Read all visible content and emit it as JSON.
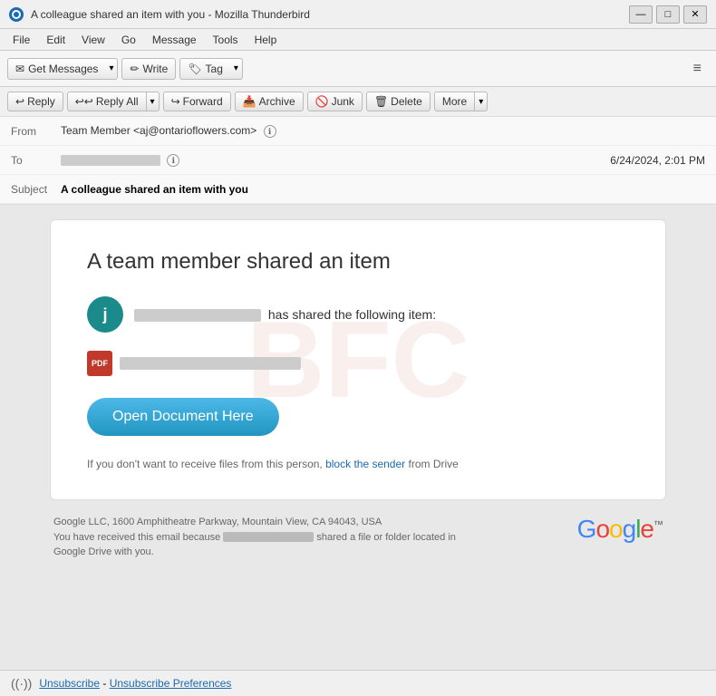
{
  "window": {
    "title": "A colleague shared an item with you - Mozilla Thunderbird",
    "controls": {
      "minimize": "—",
      "maximize": "□",
      "close": "✕"
    }
  },
  "menubar": {
    "items": [
      "File",
      "Edit",
      "View",
      "Go",
      "Message",
      "Tools",
      "Help"
    ]
  },
  "toolbar": {
    "get_messages_label": "Get Messages",
    "write_label": "Write",
    "tag_label": "Tag",
    "hamburger": "≡"
  },
  "email_actions": {
    "reply_label": "Reply",
    "reply_all_label": "Reply All",
    "forward_label": "Forward",
    "archive_label": "Archive",
    "junk_label": "Junk",
    "delete_label": "Delete",
    "more_label": "More"
  },
  "email_header": {
    "from_label": "From",
    "from_value": "Team Member <aj@ontarioflowers.com>",
    "to_label": "To",
    "date": "6/24/2024, 2:01 PM",
    "subject_label": "Subject",
    "subject_value": "A colleague shared an item with you"
  },
  "email_body": {
    "card_title": "A team member shared an item",
    "sender_text": "has shared the following item:",
    "open_btn_label": "Open Document Here",
    "footer_note_prefix": "If you don't want to receive files from this person,",
    "block_link_text": "block the sender",
    "footer_note_suffix": "from Drive"
  },
  "google_footer": {
    "address": "Google LLC, 1600 Amphitheatre Parkway, Mountain View, CA 94043, USA",
    "notice_prefix": "You have received this email because",
    "notice_suffix": "shared a file or folder located in Google Drive with you.",
    "logo_text": "Google"
  },
  "bottom": {
    "unsubscribe_label": "Unsubscribe",
    "separator": " - ",
    "prefs_label": "Unsubscribe Preferences"
  }
}
